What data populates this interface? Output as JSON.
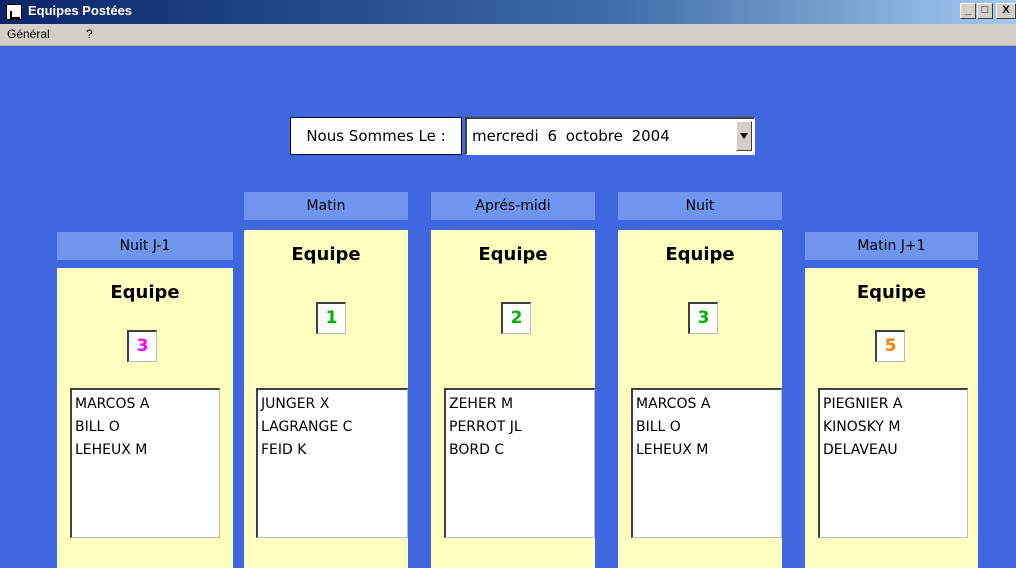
{
  "window": {
    "title": "Equipes Postées",
    "buttons": {
      "minimize": "_",
      "maximize": "□",
      "close": "X"
    }
  },
  "menu": {
    "items": [
      "Général",
      "?"
    ]
  },
  "date": {
    "label": "Nous Sommes Le :",
    "value": "mercredi  6  octobre  2004"
  },
  "headers": {
    "matin": "Matin",
    "apres_midi": "Aprés-midi",
    "nuit": "Nuit"
  },
  "columns": [
    {
      "header": "Nuit J-1",
      "title": "Equipe",
      "team": "3",
      "color": "#ff00ff",
      "members": [
        "MARCOS A",
        "BILL O",
        "LEHEUX M"
      ]
    },
    {
      "header": "",
      "title": "Equipe",
      "team": "1",
      "color": "#00b400",
      "members": [
        "JUNGER X",
        "LAGRANGE C",
        "FEID K"
      ]
    },
    {
      "header": "",
      "title": "Equipe",
      "team": "2",
      "color": "#00b400",
      "members": [
        "ZEHER M",
        "PERROT JL",
        "BORD C"
      ]
    },
    {
      "header": "",
      "title": "Equipe",
      "team": "3",
      "color": "#00b400",
      "members": [
        "MARCOS A",
        "BILL O",
        "LEHEUX M"
      ]
    },
    {
      "header": "Matin J+1",
      "title": "Equipe",
      "team": "5",
      "color": "#ff7f00",
      "members": [
        "PIEGNIER A",
        "KINOSKY M",
        "DELAVEAU"
      ]
    }
  ],
  "colors": {
    "background": "#3f68e0",
    "panel": "#ffffc0",
    "header": "#6f96ef"
  }
}
